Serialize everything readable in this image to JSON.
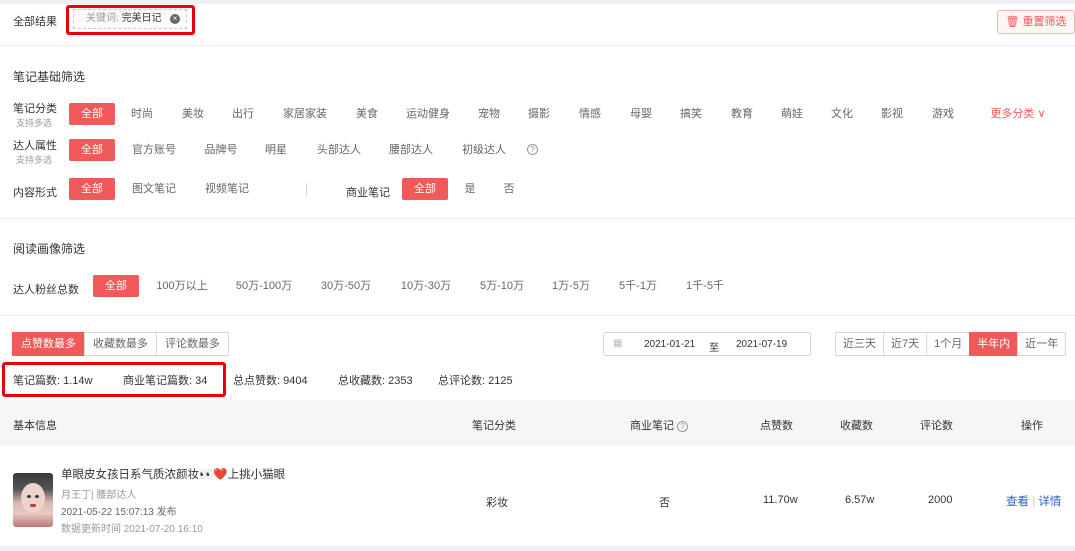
{
  "top": {
    "all_results_label": "全部结果",
    "keyword_prefix": "关键词:",
    "keyword_value": "完美日记",
    "reset_label": "重置筛选"
  },
  "basic_filter": {
    "title": "笔记基础筛选",
    "category": {
      "label": "笔记分类",
      "sub": "支持多选",
      "options": [
        "全部",
        "时尚",
        "美妆",
        "出行",
        "家居家装",
        "美食",
        "运动健身",
        "宠物",
        "摄影",
        "情感",
        "母婴",
        "搞笑",
        "教育",
        "萌娃",
        "文化",
        "影视",
        "游戏"
      ],
      "more_label": "更多分类"
    },
    "kol": {
      "label": "达人属性",
      "sub": "支持多选",
      "options": [
        "全部",
        "官方账号",
        "品牌号",
        "明星",
        "头部达人",
        "腰部达人",
        "初级达人"
      ],
      "help_icon": "question-circle-icon"
    },
    "content": {
      "label": "内容形式",
      "options": [
        "全部",
        "图文笔记",
        "视频笔记"
      ]
    },
    "commercial": {
      "label": "商业笔记",
      "options": [
        "全部",
        "是",
        "否"
      ]
    }
  },
  "audience_filter": {
    "title": "阅读画像筛选",
    "fans": {
      "label": "达人粉丝总数",
      "options": [
        "全部",
        "100万以上",
        "50万-100万",
        "30万-50万",
        "10万-30万",
        "5万-10万",
        "1万-5万",
        "5千-1万",
        "1千-5千"
      ]
    }
  },
  "sort": {
    "options": [
      "点赞数最多",
      "收藏数最多",
      "评论数最多"
    ],
    "active": "点赞数最多"
  },
  "date_range": {
    "start": "2021-01-21",
    "sep": "至",
    "end": "2021-07-19"
  },
  "quick_range": {
    "options": [
      "近三天",
      "近7天",
      "1个月",
      "半年内",
      "近一年"
    ],
    "active": "半年内"
  },
  "stats": {
    "notes": "笔记篇数: 1.14w",
    "commercial_notes": "商业笔记篇数: 34",
    "likes": "总点赞数: 9404",
    "collects": "总收藏数: 2353",
    "comments": "总评论数: 2125"
  },
  "table": {
    "headers": {
      "basic": "基本信息",
      "category": "笔记分类",
      "commercial": "商业笔记",
      "likes": "点赞数",
      "collects": "收藏数",
      "comments": "评论数",
      "action": "操作"
    },
    "rows": [
      {
        "title": "单眼皮女孩日系气质浓颜妆👀❤️上挑小猫眼",
        "author": "月王丁| 腰部达人",
        "published": "2021-05-22 15:07:13 发布",
        "updated": "数据更新时间 2021-07-20 16:10",
        "category": "彩妆",
        "commercial": "否",
        "likes": "11.70w",
        "collects": "6.57w",
        "comments": "2000",
        "view": "查看",
        "sep": "|",
        "detail": "详情"
      }
    ]
  },
  "colors": {
    "accent": "#f05a5a",
    "link": "#2a5fc9",
    "highlight_box": "#e8000b"
  }
}
